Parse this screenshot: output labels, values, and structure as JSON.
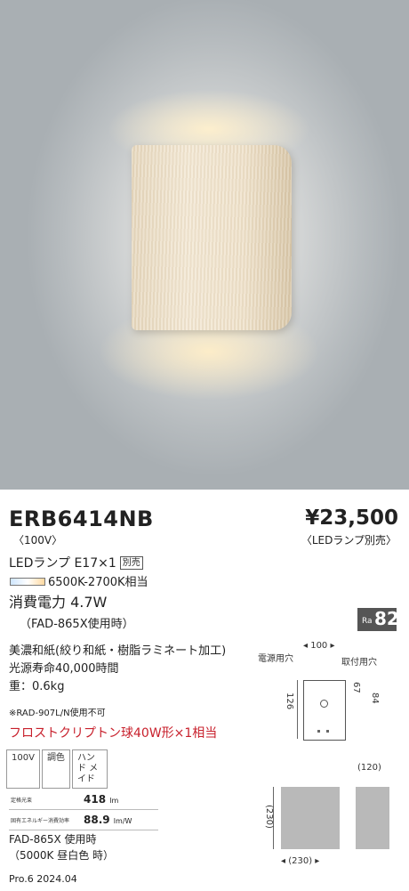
{
  "product": {
    "model": "ERB6414NB",
    "voltage": "〈100V〉",
    "price": "¥23,500",
    "price_note": "〈LEDランプ別売〉"
  },
  "spec": {
    "lamp": "LEDランプ E17×1",
    "lamp_badge": "別売",
    "color_temp": "6500K-2700K相当",
    "power": "消費電力 4.7W",
    "power_note": "（FAD-865X使用時）",
    "ra_prefix": "Ra",
    "ra_value": "82",
    "material": "美濃和紙(絞り和紙・樹脂ラミネート加工)",
    "life": "光源寿命40,000時間",
    "weight": "重：0.6kg",
    "note": "※RAD-907L/N使用不可",
    "equivalent": "フロストクリプトン球40W形×1相当"
  },
  "tags": [
    "100V",
    "調色",
    "ハンド メイド"
  ],
  "table": [
    {
      "label": "定格光束",
      "value": "418",
      "unit": "lm"
    },
    {
      "label": "固有エネルギー消費効率",
      "value": "88.9",
      "unit": "lm/W"
    }
  ],
  "fad_lines": [
    "FAD-865X 使用時",
    "（5000K 昼白色 時）"
  ],
  "footer": "Pro.6 2024.04",
  "diagram": {
    "label_power_hole": "電源用穴",
    "label_mount_hole": "取付用穴",
    "dim_100": "100",
    "dim_126": "126",
    "dim_67": "67",
    "dim_84": "84",
    "dim_120": "(120)",
    "dim_230_v": "(230)",
    "dim_230_h": "(230)"
  }
}
